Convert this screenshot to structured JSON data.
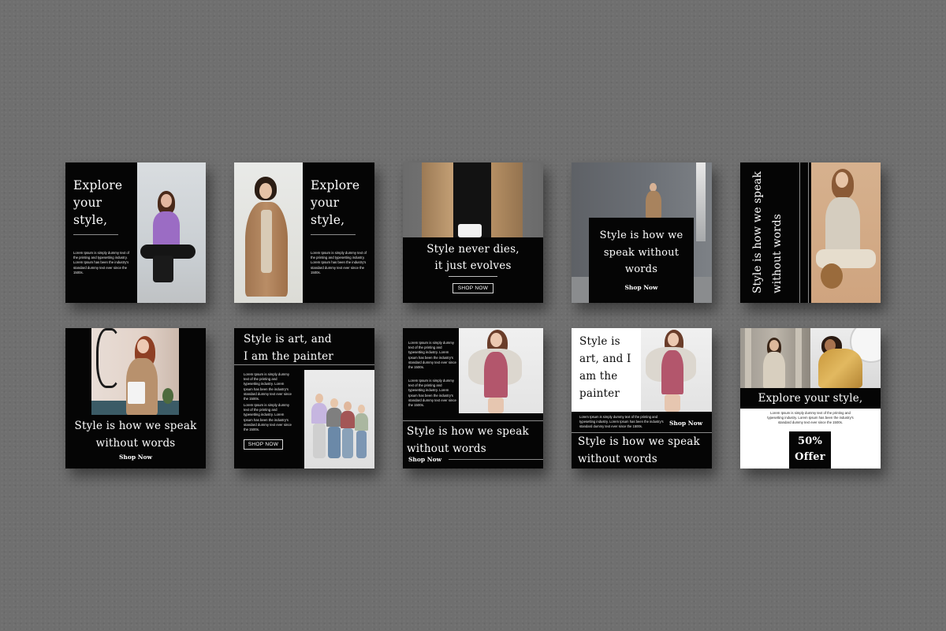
{
  "colors": {
    "background": "#6f6f6f",
    "card": "#050505",
    "text": "#ffffff",
    "offer_box": "#050505",
    "white_panel": "#ffffff"
  },
  "cards": [
    {
      "id": "card-1",
      "headline": [
        "Explore",
        "your",
        "style,"
      ],
      "body": "Lorem Ipsum is simply dummy text of the printing and typesetting industry. Lorem Ipsum has been the industry's standard dummy text ever since the 1500s."
    },
    {
      "id": "card-2",
      "headline": [
        "Explore",
        "your",
        "style,"
      ],
      "body": "Lorem Ipsum is simply dummy text of the printing and typesetting industry. Lorem Ipsum has been the industry's standard dummy text ever since the 1500s."
    },
    {
      "id": "card-3",
      "headline": [
        "Style never dies,",
        "it just evolves"
      ],
      "button": "SHOP NOW"
    },
    {
      "id": "card-4",
      "headline": [
        "Style is how we",
        "speak without",
        "words"
      ],
      "button": "Shop Now"
    },
    {
      "id": "card-5",
      "vertical_lines": [
        "Style is how we speak",
        "without words"
      ]
    },
    {
      "id": "card-6",
      "headline": [
        "Style is how we speak",
        "without words"
      ],
      "button": "Shop Now"
    },
    {
      "id": "card-7",
      "headline": [
        "Style is art, and",
        "I am the painter"
      ],
      "body_1": "Lorem Ipsum is simply dummy text of the printing and typesetting industry. Lorem Ipsum has been the industry's standard dummy text ever since the 1500s.",
      "body_2": "Lorem Ipsum is simply dummy text of the printing and typesetting industry. Lorem Ipsum has been the industry's standard dummy text ever since the 1500s.",
      "button": "SHOP NOW"
    },
    {
      "id": "card-8",
      "body_1": "Lorem Ipsum is simply dummy text of the printing and typesetting industry. Lorem Ipsum has been the industry's standard dummy text ever since the 1500s.",
      "body_2": "Lorem Ipsum is simply dummy text of the printing and typesetting industry. Lorem Ipsum has been the industry's standard dummy text ever since the 1500s.",
      "headline": [
        "Style is how we speak",
        "without words"
      ],
      "button": "Shop Now"
    },
    {
      "id": "card-9",
      "headline_top": [
        "Style is",
        "art, and I",
        "am the",
        "painter"
      ],
      "body": "Lorem Ipsum is simply dummy text of the printing and typesetting industry. Lorem Ipsum has been the industry's standard dummy text ever since the 1500s.",
      "button": "Shop Now",
      "headline_bottom": [
        "Style is how we speak",
        "without words"
      ]
    },
    {
      "id": "card-10",
      "headline": "Explore your style,",
      "body": "Lorem Ipsum is simply dummy text of the printing and typesetting industry. Lorem Ipsum has been the industry's standard dummy text ever since the 1500s.",
      "offer": [
        "50%",
        "Offer"
      ]
    }
  ]
}
